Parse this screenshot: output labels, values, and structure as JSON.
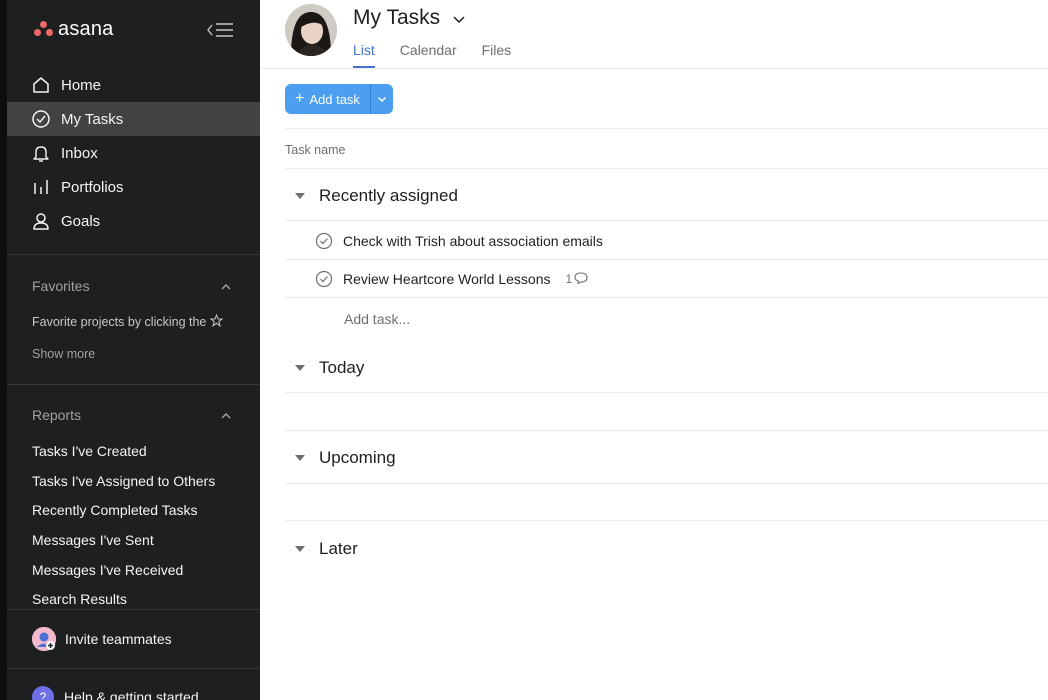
{
  "app": {
    "brand": "asana"
  },
  "colors": {
    "sidebar_bg": "#1e1f21",
    "active_item": "#424244",
    "accent": "#4573d2",
    "add_button": "#4c9ef0",
    "logo": "#f06a6a"
  },
  "sidebar": {
    "nav": [
      {
        "label": "Home",
        "icon": "home-icon"
      },
      {
        "label": "My Tasks",
        "icon": "check-circle-icon",
        "active": true
      },
      {
        "label": "Inbox",
        "icon": "bell-icon"
      },
      {
        "label": "Portfolios",
        "icon": "bar-chart-icon"
      },
      {
        "label": "Goals",
        "icon": "person-icon"
      }
    ],
    "favorites": {
      "title": "Favorites",
      "hint": "Favorite projects by clicking the",
      "show_more": "Show more"
    },
    "reports": {
      "title": "Reports",
      "items": [
        "Tasks I've Created",
        "Tasks I've Assigned to Others",
        "Recently Completed Tasks",
        "Messages I've Sent",
        "Messages I've Received",
        "Search Results"
      ]
    },
    "invite": "Invite teammates",
    "help": "Help & getting started",
    "help_icon_text": "?"
  },
  "main": {
    "title": "My Tasks",
    "tabs": [
      {
        "label": "List",
        "active": true
      },
      {
        "label": "Calendar"
      },
      {
        "label": "Files"
      }
    ],
    "add_task_label": "Add task",
    "column_header": "Task name",
    "sections": [
      {
        "title": "Recently assigned",
        "tasks": [
          {
            "name": "Check with Trish about association emails"
          },
          {
            "name": "Review Heartcore World Lessons",
            "comments": "1"
          }
        ],
        "add_placeholder": "Add task..."
      },
      {
        "title": "Today"
      },
      {
        "title": "Upcoming"
      },
      {
        "title": "Later"
      }
    ]
  }
}
